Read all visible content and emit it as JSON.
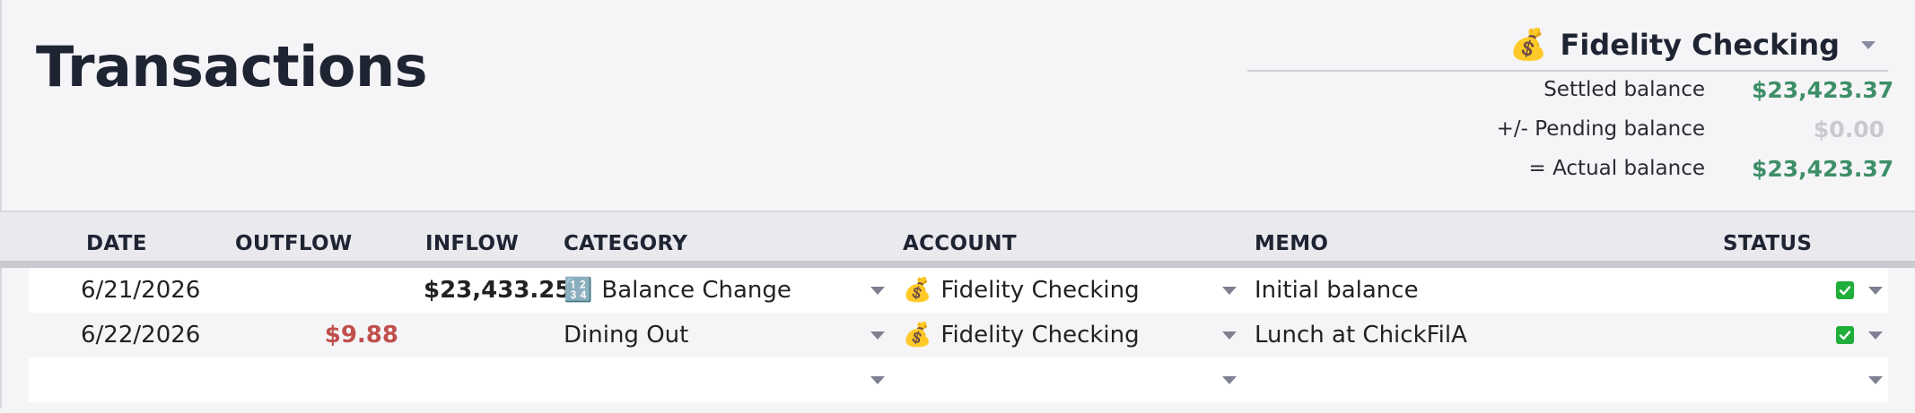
{
  "page": {
    "title": "Transactions"
  },
  "account_selector": {
    "emoji": "💰",
    "name": "Fidelity Checking"
  },
  "balances": [
    {
      "label": "Settled balance",
      "value": "$23,423.37",
      "tone": "green"
    },
    {
      "label": "+/- Pending balance",
      "value": "$0.00",
      "tone": "muted"
    },
    {
      "label": "= Actual balance",
      "value": "$23,423.37",
      "tone": "green"
    }
  ],
  "table": {
    "columns": [
      "DATE",
      "OUTFLOW",
      "INFLOW",
      "CATEGORY",
      "ACCOUNT",
      "MEMO",
      "STATUS"
    ],
    "rows": [
      {
        "date": "6/21/2026",
        "outflow": "",
        "inflow": "$23,433.25",
        "category_icon": "🔢",
        "category": "Balance Change",
        "account_icon": "💰",
        "account": "Fidelity Checking",
        "memo": "Initial balance",
        "status": "cleared"
      },
      {
        "date": "6/22/2026",
        "outflow": "$9.88",
        "inflow": "",
        "category_icon": "",
        "category": "Dining Out",
        "account_icon": "💰",
        "account": "Fidelity Checking",
        "memo": "Lunch at ChickFilA",
        "status": "cleared"
      }
    ]
  },
  "colors": {
    "positive": "#3e8f68",
    "negative": "#c0504d",
    "status_cleared": "#1fae3a"
  }
}
